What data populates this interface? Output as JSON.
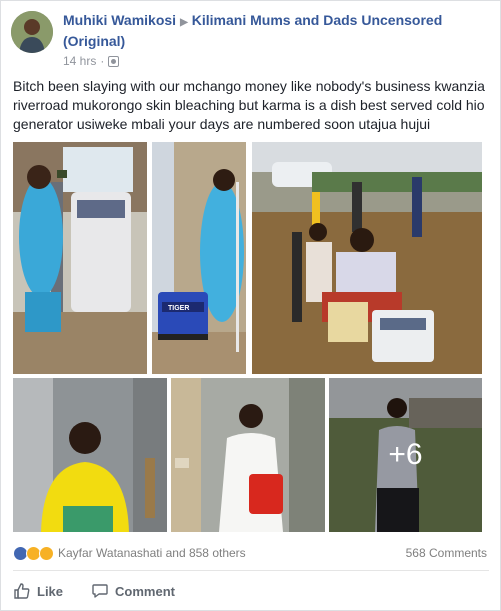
{
  "post": {
    "author": "Muhiki Wamikosi",
    "group": "Kilimani Mums and Dads Uncensored (Original)",
    "time": "14 hrs",
    "separator": "·",
    "text": "Bitch been slaying with our mchango money like nobody's business kwanzia riverroad mukorongo skin bleaching but karma is a dish best served cold hio generator usiweke mbali your days are numbered soon utajua hujui"
  },
  "photos": {
    "more_label": "+6",
    "generator_brand": "TIGER"
  },
  "reactions": {
    "summary": "Kayfar Watanashati and 858 others",
    "comments": "568 Comments",
    "icons": [
      "like-icon",
      "haha-icon",
      "sad-icon"
    ]
  },
  "actions": {
    "like": "Like",
    "comment": "Comment"
  },
  "colors": {
    "link": "#365899",
    "muted": "#90949c",
    "like_blue": "#4267b2"
  }
}
